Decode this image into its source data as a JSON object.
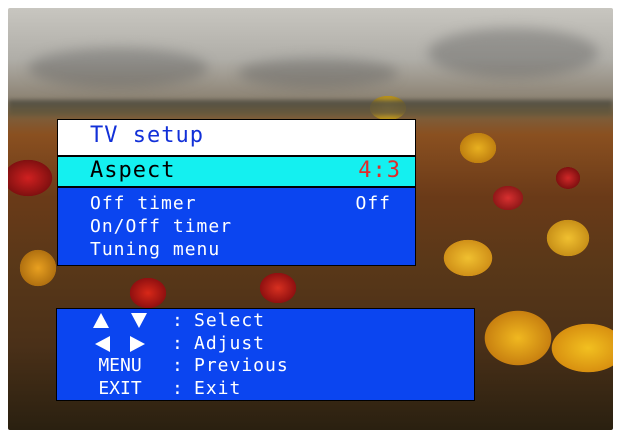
{
  "menu": {
    "title": "TV setup",
    "selected": {
      "label": "Aspect",
      "value": "4:3"
    },
    "items": [
      {
        "label": "Off timer",
        "value": "Off"
      },
      {
        "label": "On/Off timer",
        "value": ""
      },
      {
        "label": "Tuning menu",
        "value": ""
      }
    ]
  },
  "help": {
    "separator": ":",
    "rows": [
      {
        "key_icons": [
          "up-arrow-icon",
          "down-arrow-icon"
        ],
        "action": "Select"
      },
      {
        "key_icons": [
          "left-arrow-icon",
          "right-arrow-icon"
        ],
        "action": "Adjust"
      },
      {
        "key": "MENU",
        "action": "Previous"
      },
      {
        "key": "EXIT",
        "action": "Exit"
      }
    ]
  },
  "colors": {
    "panel_blue": "#0b45f0",
    "highlight_cyan": "#14f0f0",
    "value_red": "#e02a2a",
    "title_blue": "#1230d8"
  }
}
